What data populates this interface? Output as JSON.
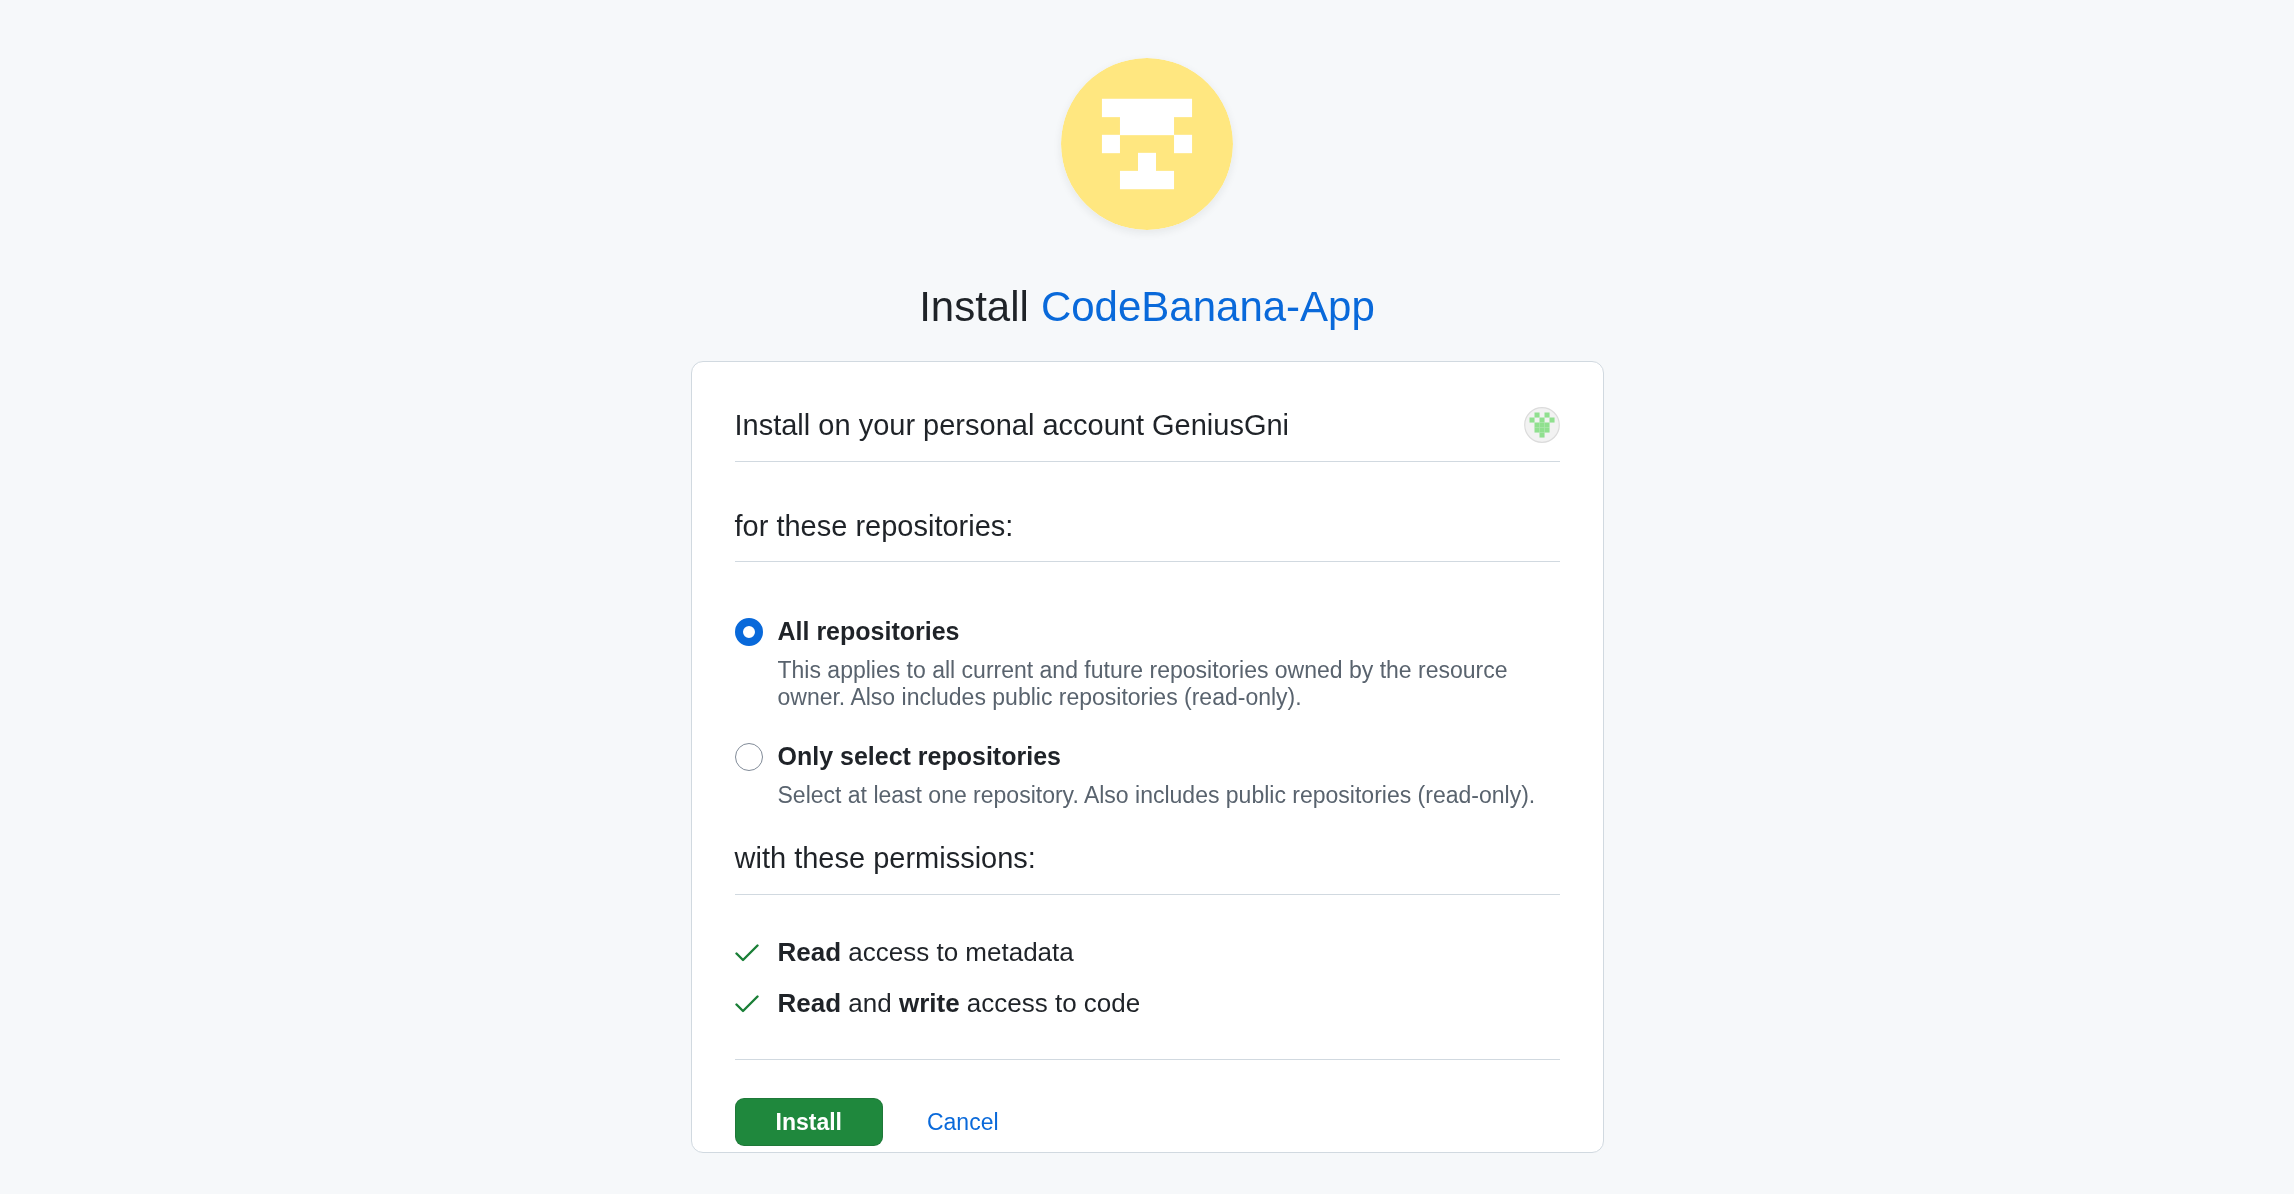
{
  "heading": {
    "prefix": "Install",
    "app_name": "CodeBanana-App"
  },
  "account": {
    "text": "Install on your personal account GeniusGni"
  },
  "repositories": {
    "label": "for these repositories:",
    "options": [
      {
        "label": "All repositories",
        "description": "This applies to all current and future repositories owned by the resource owner. Also includes public repositories (read-only).",
        "selected": true
      },
      {
        "label": "Only select repositories",
        "description": "Select at least one repository. Also includes public repositories (read-only).",
        "selected": false
      }
    ]
  },
  "permissions": {
    "label": "with these permissions:",
    "items": [
      {
        "text": "**Read** access to metadata"
      },
      {
        "text": "**Read** and **write** access to code"
      }
    ]
  },
  "buttons": [
    {
      "kind": "primary",
      "label": "Install"
    },
    {
      "kind": "link",
      "label": "Cancel"
    }
  ]
}
